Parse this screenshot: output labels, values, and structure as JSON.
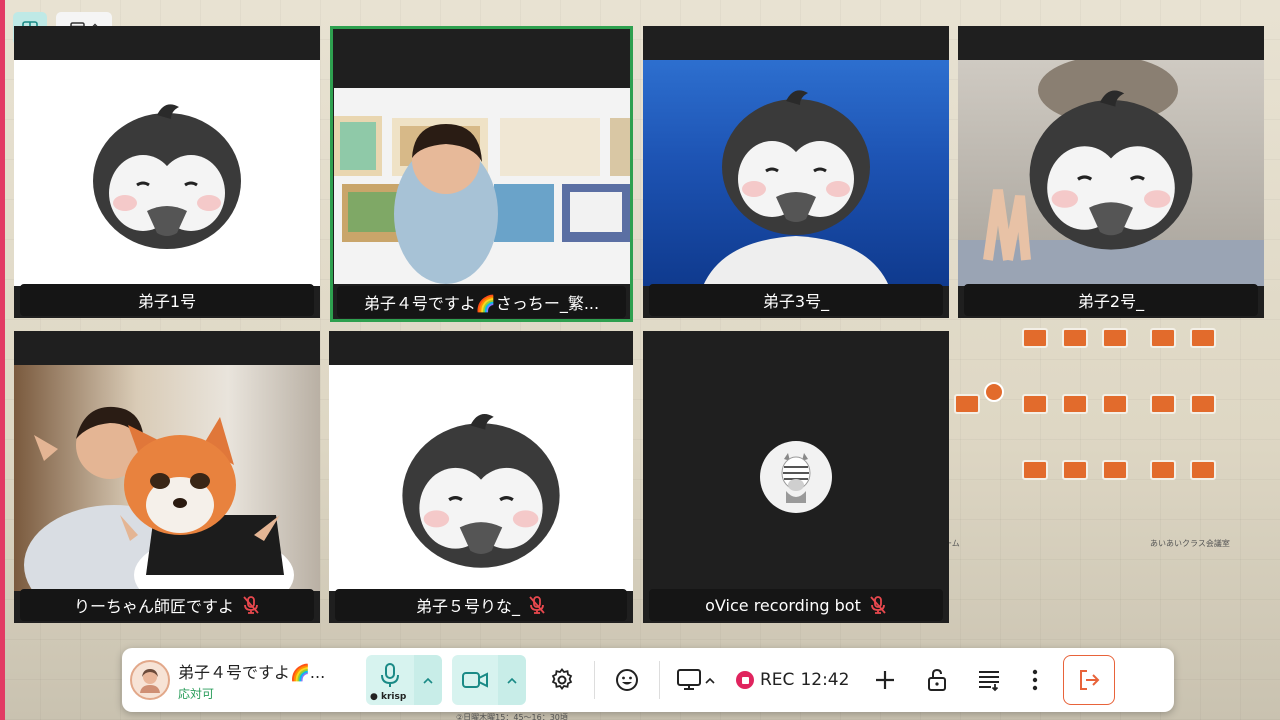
{
  "top_controls": {
    "grid_view_icon": "grid-icon",
    "layout_icon": "layout-icon",
    "layout_caret_icon": "updown-caret-icon"
  },
  "tiles": [
    {
      "name": "弟子1号",
      "muted": false,
      "video": "penguin-avatar",
      "active": false
    },
    {
      "name": "弟子４号ですよ🌈さっちー_繁...",
      "muted": false,
      "video": "camera-screen-share",
      "active": true
    },
    {
      "name": "弟子3号_",
      "muted": false,
      "video": "penguin-avatar-ocean",
      "active": false
    },
    {
      "name": "弟子2号_",
      "muted": false,
      "video": "penguin-avatar-cat",
      "active": false
    },
    {
      "name": "りーちゃん師匠ですよ",
      "muted": true,
      "video": "fox-avatar",
      "active": false
    },
    {
      "name": "弟子５号りな_",
      "muted": true,
      "video": "penguin-avatar",
      "active": false
    },
    {
      "name": "oVice recording bot",
      "muted": true,
      "video": "zebra-avatar",
      "active": false
    }
  ],
  "toolbar": {
    "user_name": "弟子４号ですよ🌈...",
    "user_status": "応対可",
    "krisp_label": "● krisp",
    "rec_label": "REC",
    "rec_time": "12:42",
    "colors": {
      "accent": "#2ea04f",
      "media_bg": "#d7f3ef",
      "rec": "#e0245e",
      "leave": "#e8633a",
      "status": "#2a9d5b"
    }
  },
  "map": {
    "label_1": "ーム",
    "label_2": "あいあいクラス会議室",
    "label_3": "②日曜木曜15：45～16：30頃"
  }
}
